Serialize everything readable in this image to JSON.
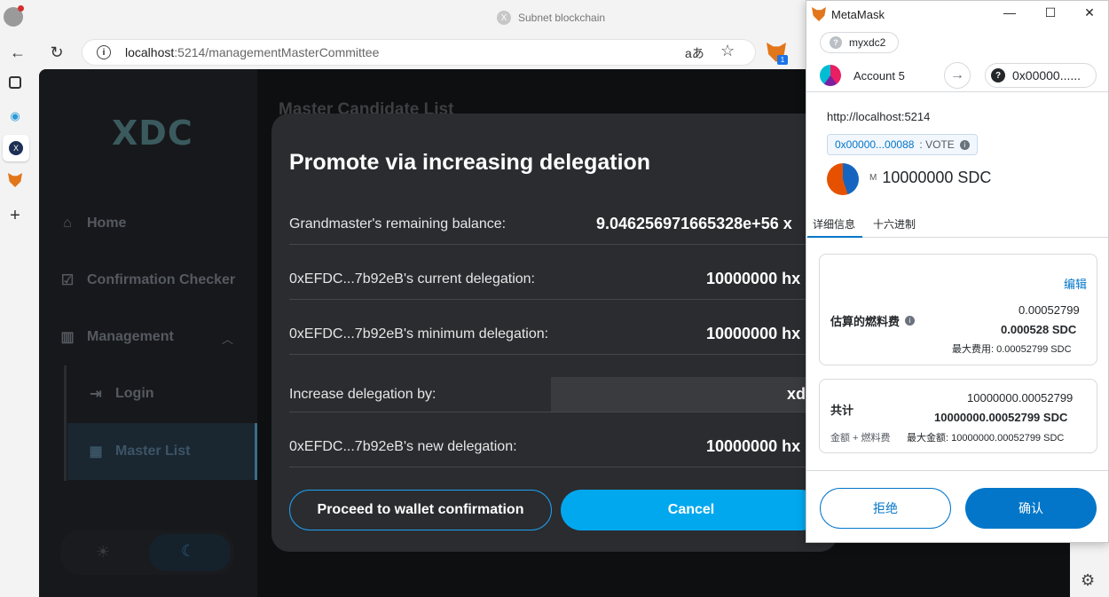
{
  "browser": {
    "tab_title": "Subnet blockchain",
    "url_host": "localhost",
    "url_path": ":5214/managementMasterCommittee",
    "read_aloud": "aあ"
  },
  "sidebar": {
    "logo": "XDC",
    "items": [
      {
        "label": "Home",
        "icon": "home-icon"
      },
      {
        "label": "Confirmation Checker",
        "icon": "checklist-icon"
      },
      {
        "label": "Management",
        "icon": "chart-icon"
      },
      {
        "label": "Login",
        "icon": "login-icon"
      },
      {
        "label": "Master List",
        "icon": "table-icon"
      }
    ]
  },
  "page": {
    "background_heading": "Master Candidate List"
  },
  "modal": {
    "title": "Promote via increasing delegation",
    "rows": [
      {
        "label": "Grandmaster's remaining balance:",
        "value": "9.046256971665328e+56 x"
      },
      {
        "label": "0xEFDC...7b92eB's current delegation:",
        "value": "10000000 hx"
      },
      {
        "label": "0xEFDC...7b92eB's minimum delegation:",
        "value": "10000000 hx"
      },
      {
        "label": "Increase delegation by:",
        "value": "xd"
      },
      {
        "label": "0xEFDC...7b92eB's new delegation:",
        "value": "10000000 hx"
      }
    ],
    "proceed_label": "Proceed to wallet confirmation",
    "cancel_label": "Cancel"
  },
  "metamask": {
    "window_title": "MetaMask",
    "network": "myxdc2",
    "network_icon_text": "?",
    "account": "Account 5",
    "to_address": "0x00000......",
    "to_icon_text": "?",
    "origin": "http://localhost:5214",
    "contract_address": "0x00000...00088",
    "contract_method": ": VOTE",
    "amount": "10000000 SDC",
    "amount_symbol": "M",
    "tabs": [
      "详细信息",
      "十六进制"
    ],
    "edit_label": "编辑",
    "gas_label": "估算的燃料费",
    "gas_value": "0.00052799",
    "gas_value_sdc": "0.000528 SDC",
    "gas_max": "最大费用: 0.00052799 SDC",
    "total_label": "共计",
    "total_value": "10000000.00052799",
    "total_value_sdc": "10000000.00052799 SDC",
    "total_sub": "金额 + 燃料费",
    "total_max": "最大金额: 10000000.00052799 SDC",
    "reject_label": "拒绝",
    "confirm_label": "确认"
  },
  "colors": {
    "accent": "#02a8ee",
    "metamask_blue": "#0376c9",
    "modal_bg": "#2b2c30",
    "app_bg": "#0e0f11"
  }
}
